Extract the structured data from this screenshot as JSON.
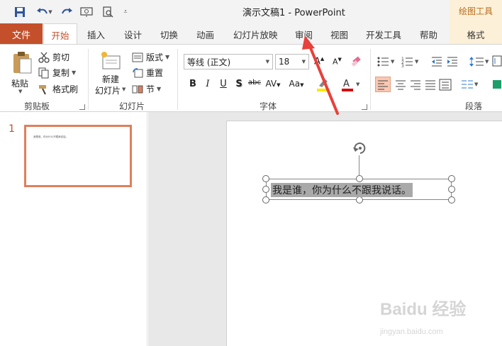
{
  "app": {
    "title": "演示文稿1  -  PowerPoint",
    "context_tab_group": "绘图工具"
  },
  "tabs": [
    {
      "label": "文件"
    },
    {
      "label": "开始"
    },
    {
      "label": "插入"
    },
    {
      "label": "设计"
    },
    {
      "label": "切换"
    },
    {
      "label": "动画"
    },
    {
      "label": "幻灯片放映"
    },
    {
      "label": "审阅"
    },
    {
      "label": "视图"
    },
    {
      "label": "开发工具"
    },
    {
      "label": "帮助"
    },
    {
      "label": "格式"
    }
  ],
  "clipboard": {
    "paste": "粘贴",
    "cut": "剪切",
    "copy": "复制",
    "format_painter": "格式刷",
    "group_label": "剪贴板"
  },
  "slides_group": {
    "new_slide_line1": "新建",
    "new_slide_line2": "幻灯片",
    "layout": "版式",
    "reset": "重置",
    "section": "节",
    "group_label": "幻灯片"
  },
  "font_group": {
    "font_name": "等线 (正文)",
    "font_size": "18",
    "bold": "B",
    "italic": "I",
    "underline": "U",
    "shadow": "S",
    "strike": "abc",
    "spacing": "AV",
    "case": "Aa",
    "group_label": "字体"
  },
  "paragraph_group": {
    "group_label": "段落"
  },
  "thumbnails": [
    {
      "number": "1",
      "text": "我是谁，你为什么不跟我说话。"
    }
  ],
  "slide": {
    "text": "我是谁，你为什么不跟我说话。"
  },
  "watermark": {
    "brand": "Baidu 经验",
    "url": "jingyan.baidu.com"
  },
  "colors": {
    "accent": "#c3502b",
    "context_tab": "#fdf0d8",
    "selection": "#a9a9a9",
    "annotation_arrow": "#e8403a"
  }
}
